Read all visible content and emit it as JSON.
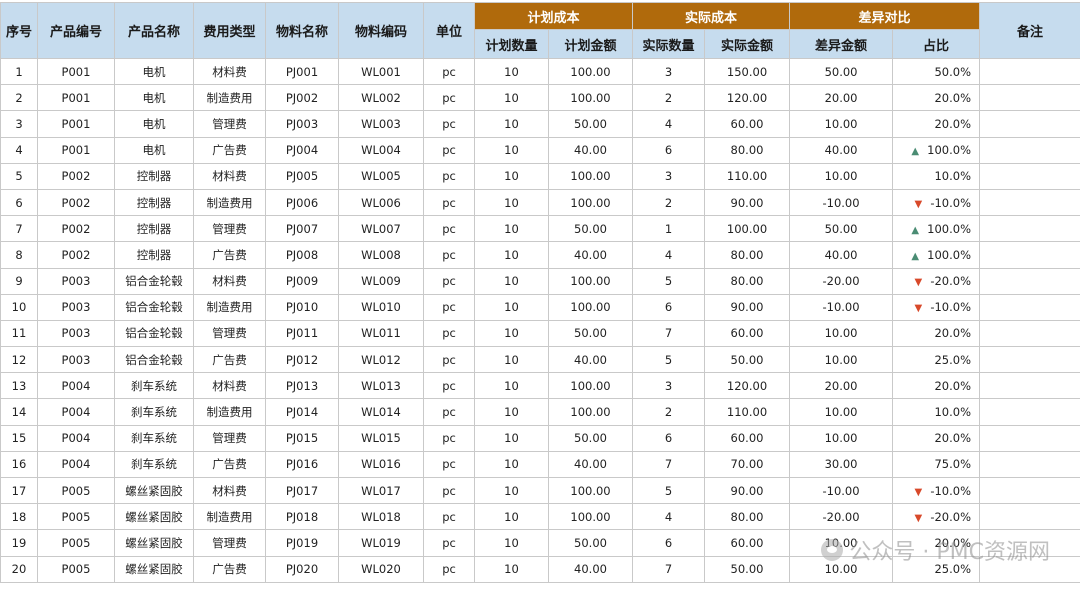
{
  "headers": {
    "seq": "序号",
    "product_code": "产品编号",
    "product_name": "产品名称",
    "cost_type": "费用类型",
    "material_name": "物料名称",
    "material_code": "物料编码",
    "unit": "单位",
    "plan_group": "计划成本",
    "plan_qty": "计划数量",
    "plan_amount": "计划金额",
    "actual_group": "实际成本",
    "actual_qty": "实际数量",
    "actual_amount": "实际金额",
    "diff_group": "差异对比",
    "diff_amount": "差异金额",
    "ratio": "占比",
    "remark": "备注"
  },
  "rows": [
    {
      "seq": "1",
      "pcode": "P001",
      "pname": "电机",
      "ctype": "材料费",
      "mname": "PJ001",
      "mcode": "WL001",
      "unit": "pc",
      "pqty": "10",
      "pamt": "100.00",
      "aqty": "3",
      "aamt": "150.00",
      "damt": "50.00",
      "ratio": "50.0%",
      "trend": "",
      "remark": ""
    },
    {
      "seq": "2",
      "pcode": "P001",
      "pname": "电机",
      "ctype": "制造费用",
      "mname": "PJ002",
      "mcode": "WL002",
      "unit": "pc",
      "pqty": "10",
      "pamt": "100.00",
      "aqty": "2",
      "aamt": "120.00",
      "damt": "20.00",
      "ratio": "20.0%",
      "trend": "",
      "remark": ""
    },
    {
      "seq": "3",
      "pcode": "P001",
      "pname": "电机",
      "ctype": "管理费",
      "mname": "PJ003",
      "mcode": "WL003",
      "unit": "pc",
      "pqty": "10",
      "pamt": "50.00",
      "aqty": "4",
      "aamt": "60.00",
      "damt": "10.00",
      "ratio": "20.0%",
      "trend": "",
      "remark": ""
    },
    {
      "seq": "4",
      "pcode": "P001",
      "pname": "电机",
      "ctype": "广告费",
      "mname": "PJ004",
      "mcode": "WL004",
      "unit": "pc",
      "pqty": "10",
      "pamt": "40.00",
      "aqty": "6",
      "aamt": "80.00",
      "damt": "40.00",
      "ratio": "100.0%",
      "trend": "up",
      "remark": ""
    },
    {
      "seq": "5",
      "pcode": "P002",
      "pname": "控制器",
      "ctype": "材料费",
      "mname": "PJ005",
      "mcode": "WL005",
      "unit": "pc",
      "pqty": "10",
      "pamt": "100.00",
      "aqty": "3",
      "aamt": "110.00",
      "damt": "10.00",
      "ratio": "10.0%",
      "trend": "",
      "remark": ""
    },
    {
      "seq": "6",
      "pcode": "P002",
      "pname": "控制器",
      "ctype": "制造费用",
      "mname": "PJ006",
      "mcode": "WL006",
      "unit": "pc",
      "pqty": "10",
      "pamt": "100.00",
      "aqty": "2",
      "aamt": "90.00",
      "damt": "-10.00",
      "ratio": "-10.0%",
      "trend": "down",
      "remark": ""
    },
    {
      "seq": "7",
      "pcode": "P002",
      "pname": "控制器",
      "ctype": "管理费",
      "mname": "PJ007",
      "mcode": "WL007",
      "unit": "pc",
      "pqty": "10",
      "pamt": "50.00",
      "aqty": "1",
      "aamt": "100.00",
      "damt": "50.00",
      "ratio": "100.0%",
      "trend": "up",
      "remark": ""
    },
    {
      "seq": "8",
      "pcode": "P002",
      "pname": "控制器",
      "ctype": "广告费",
      "mname": "PJ008",
      "mcode": "WL008",
      "unit": "pc",
      "pqty": "10",
      "pamt": "40.00",
      "aqty": "4",
      "aamt": "80.00",
      "damt": "40.00",
      "ratio": "100.0%",
      "trend": "up",
      "remark": ""
    },
    {
      "seq": "9",
      "pcode": "P003",
      "pname": "铝合金轮毂",
      "ctype": "材料费",
      "mname": "PJ009",
      "mcode": "WL009",
      "unit": "pc",
      "pqty": "10",
      "pamt": "100.00",
      "aqty": "5",
      "aamt": "80.00",
      "damt": "-20.00",
      "ratio": "-20.0%",
      "trend": "down",
      "remark": ""
    },
    {
      "seq": "10",
      "pcode": "P003",
      "pname": "铝合金轮毂",
      "ctype": "制造费用",
      "mname": "PJ010",
      "mcode": "WL010",
      "unit": "pc",
      "pqty": "10",
      "pamt": "100.00",
      "aqty": "6",
      "aamt": "90.00",
      "damt": "-10.00",
      "ratio": "-10.0%",
      "trend": "down",
      "remark": ""
    },
    {
      "seq": "11",
      "pcode": "P003",
      "pname": "铝合金轮毂",
      "ctype": "管理费",
      "mname": "PJ011",
      "mcode": "WL011",
      "unit": "pc",
      "pqty": "10",
      "pamt": "50.00",
      "aqty": "7",
      "aamt": "60.00",
      "damt": "10.00",
      "ratio": "20.0%",
      "trend": "",
      "remark": ""
    },
    {
      "seq": "12",
      "pcode": "P003",
      "pname": "铝合金轮毂",
      "ctype": "广告费",
      "mname": "PJ012",
      "mcode": "WL012",
      "unit": "pc",
      "pqty": "10",
      "pamt": "40.00",
      "aqty": "5",
      "aamt": "50.00",
      "damt": "10.00",
      "ratio": "25.0%",
      "trend": "",
      "remark": ""
    },
    {
      "seq": "13",
      "pcode": "P004",
      "pname": "刹车系统",
      "ctype": "材料费",
      "mname": "PJ013",
      "mcode": "WL013",
      "unit": "pc",
      "pqty": "10",
      "pamt": "100.00",
      "aqty": "3",
      "aamt": "120.00",
      "damt": "20.00",
      "ratio": "20.0%",
      "trend": "",
      "remark": ""
    },
    {
      "seq": "14",
      "pcode": "P004",
      "pname": "刹车系统",
      "ctype": "制造费用",
      "mname": "PJ014",
      "mcode": "WL014",
      "unit": "pc",
      "pqty": "10",
      "pamt": "100.00",
      "aqty": "2",
      "aamt": "110.00",
      "damt": "10.00",
      "ratio": "10.0%",
      "trend": "",
      "remark": ""
    },
    {
      "seq": "15",
      "pcode": "P004",
      "pname": "刹车系统",
      "ctype": "管理费",
      "mname": "PJ015",
      "mcode": "WL015",
      "unit": "pc",
      "pqty": "10",
      "pamt": "50.00",
      "aqty": "6",
      "aamt": "60.00",
      "damt": "10.00",
      "ratio": "20.0%",
      "trend": "",
      "remark": ""
    },
    {
      "seq": "16",
      "pcode": "P004",
      "pname": "刹车系统",
      "ctype": "广告费",
      "mname": "PJ016",
      "mcode": "WL016",
      "unit": "pc",
      "pqty": "10",
      "pamt": "40.00",
      "aqty": "7",
      "aamt": "70.00",
      "damt": "30.00",
      "ratio": "75.0%",
      "trend": "",
      "remark": ""
    },
    {
      "seq": "17",
      "pcode": "P005",
      "pname": "螺丝紧固胶",
      "ctype": "材料费",
      "mname": "PJ017",
      "mcode": "WL017",
      "unit": "pc",
      "pqty": "10",
      "pamt": "100.00",
      "aqty": "5",
      "aamt": "90.00",
      "damt": "-10.00",
      "ratio": "-10.0%",
      "trend": "down",
      "remark": ""
    },
    {
      "seq": "18",
      "pcode": "P005",
      "pname": "螺丝紧固胶",
      "ctype": "制造费用",
      "mname": "PJ018",
      "mcode": "WL018",
      "unit": "pc",
      "pqty": "10",
      "pamt": "100.00",
      "aqty": "4",
      "aamt": "80.00",
      "damt": "-20.00",
      "ratio": "-20.0%",
      "trend": "down",
      "remark": ""
    },
    {
      "seq": "19",
      "pcode": "P005",
      "pname": "螺丝紧固胶",
      "ctype": "管理费",
      "mname": "PJ019",
      "mcode": "WL019",
      "unit": "pc",
      "pqty": "10",
      "pamt": "50.00",
      "aqty": "6",
      "aamt": "60.00",
      "damt": "10.00",
      "ratio": "20.0%",
      "trend": "",
      "remark": ""
    },
    {
      "seq": "20",
      "pcode": "P005",
      "pname": "螺丝紧固胶",
      "ctype": "广告费",
      "mname": "PJ020",
      "mcode": "WL020",
      "unit": "pc",
      "pqty": "10",
      "pamt": "40.00",
      "aqty": "7",
      "aamt": "50.00",
      "damt": "10.00",
      "ratio": "25.0%",
      "trend": "",
      "remark": ""
    }
  ],
  "icons": {
    "up": "arrow-up-icon",
    "down": "arrow-down-icon"
  },
  "colors": {
    "header_blue": "#c6dcee",
    "header_brown": "#b06a0c",
    "arrow_up": "#4a8c73",
    "arrow_down": "#d8492a"
  },
  "watermark": {
    "text": "公众号 · PMC资源网"
  }
}
